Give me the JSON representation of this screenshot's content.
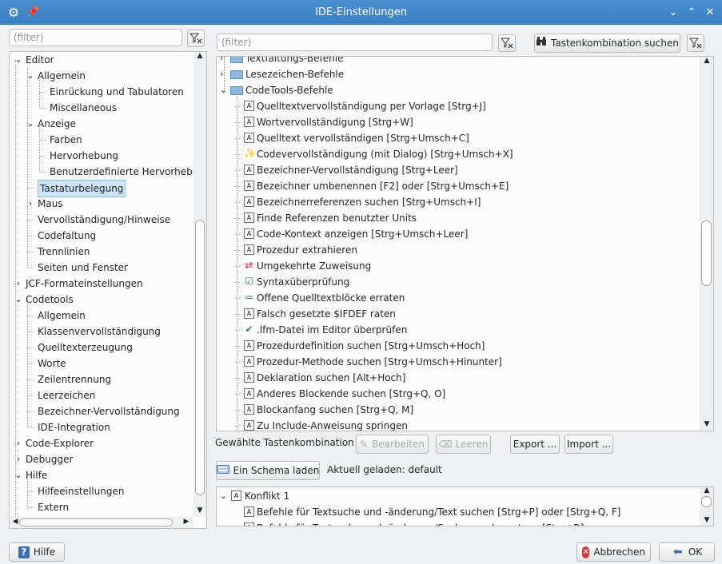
{
  "window": {
    "title": "IDE-Einstellungen",
    "app_icon": "gear-icon",
    "pin_icon": "pin-icon"
  },
  "left_filter": {
    "placeholder": "(filter)"
  },
  "tree": [
    {
      "label": "Editor",
      "level": 0,
      "expander": "down"
    },
    {
      "label": "Allgemein",
      "level": 1,
      "expander": "down"
    },
    {
      "label": "Einrückung und Tabulatoren",
      "level": 2
    },
    {
      "label": "Miscellaneous",
      "level": 2
    },
    {
      "label": "Anzeige",
      "level": 1,
      "expander": "down"
    },
    {
      "label": "Farben",
      "level": 2
    },
    {
      "label": "Hervorhebung",
      "level": 2
    },
    {
      "label": "Benutzerdefinierte Hervorhebu",
      "level": 2
    },
    {
      "label": "Tastaturbelegung",
      "level": 1,
      "selected": true
    },
    {
      "label": "Maus",
      "level": 1,
      "expander": "right"
    },
    {
      "label": "Vervollständigung/Hinweise",
      "level": 1
    },
    {
      "label": "Codefaltung",
      "level": 1
    },
    {
      "label": "Trennlinien",
      "level": 1
    },
    {
      "label": "Seiten und Fenster",
      "level": 1
    },
    {
      "label": "JCF-Formateinstellungen",
      "level": 0,
      "expander": "right"
    },
    {
      "label": "Codetools",
      "level": 0,
      "expander": "down"
    },
    {
      "label": "Allgemein",
      "level": 1
    },
    {
      "label": "Klassenvervollständigung",
      "level": 1
    },
    {
      "label": "Quelltexterzeugung",
      "level": 1
    },
    {
      "label": "Worte",
      "level": 1
    },
    {
      "label": "Zeilentrennung",
      "level": 1
    },
    {
      "label": "Leerzeichen",
      "level": 1
    },
    {
      "label": "Bezeichner-Vervollständigung",
      "level": 1
    },
    {
      "label": "IDE-Integration",
      "level": 1
    },
    {
      "label": "Code-Explorer",
      "level": 0,
      "expander": "right"
    },
    {
      "label": "Debugger",
      "level": 0,
      "expander": "right"
    },
    {
      "label": "Hilfe",
      "level": 0,
      "expander": "down"
    },
    {
      "label": "Hilfeeinstellungen",
      "level": 1
    },
    {
      "label": "Extern",
      "level": 1
    }
  ],
  "right_filter": {
    "placeholder": "(filter)"
  },
  "find_key_button": {
    "label": "Tastenkombination suchen",
    "icon": "binoculars-icon"
  },
  "commands": [
    {
      "label": "Textfaltungs-Befehle",
      "type": "folder",
      "expander": "right"
    },
    {
      "label": "Lesezeichen-Befehle",
      "type": "folder",
      "expander": "right"
    },
    {
      "label": "CodeTools-Befehle",
      "type": "folder",
      "expander": "down"
    },
    {
      "label": "Quelltextvervollständigung per Vorlage  [Strg+J]",
      "icon": "A"
    },
    {
      "label": "Wortvervollständigung  [Strg+W]",
      "icon": "A"
    },
    {
      "label": "Quelltext vervollständigen  [Strg+Umsch+C]",
      "icon": "A"
    },
    {
      "label": "Codevervollständigung (mit Dialog)  [Strg+Umsch+X]",
      "icon": "wand"
    },
    {
      "label": "Bezeichner-Vervollständigung  [Strg+Leer]",
      "icon": "A"
    },
    {
      "label": "Bezeichner umbenennen  [F2]  oder  [Strg+Umsch+E]",
      "icon": "A"
    },
    {
      "label": "Bezeichnerreferenzen suchen  [Strg+Umsch+I]",
      "icon": "A"
    },
    {
      "label": "Finde Referenzen benutzter Units",
      "icon": "A"
    },
    {
      "label": "Code-Kontext anzeigen  [Strg+Umsch+Leer]",
      "icon": "A"
    },
    {
      "label": "Prozedur extrahieren",
      "icon": "A"
    },
    {
      "label": "Umgekehrte Zuweisung",
      "icon": "swap"
    },
    {
      "label": "Syntaxüberprüfung",
      "icon": "syntax"
    },
    {
      "label": "Offene Quelltextblöcke erraten",
      "icon": "guess"
    },
    {
      "label": "Falsch gesetzte $IFDEF raten",
      "icon": "A"
    },
    {
      "label": ".lfm-Datei im Editor überprüfen",
      "icon": "check"
    },
    {
      "label": "Prozedurdefinition suchen  [Strg+Umsch+Hoch]",
      "icon": "A"
    },
    {
      "label": "Prozedur-Methode suchen  [Strg+Umsch+Hinunter]",
      "icon": "A"
    },
    {
      "label": "Deklaration suchen  [Alt+Hoch]",
      "icon": "A"
    },
    {
      "label": "Anderes Blockende suchen  [Strg+Q, O]",
      "icon": "A"
    },
    {
      "label": "Blockanfang suchen  [Strg+Q, M]",
      "icon": "A"
    },
    {
      "label": "Zu Include-Anweisung springen",
      "icon": "A"
    }
  ],
  "selected_key_label": "Gewählte Tastenkombination",
  "edit_button": {
    "label": "Bearbeiten",
    "icon": "pencil-icon"
  },
  "clear_button": {
    "label": "Leeren",
    "icon": "eraser-icon"
  },
  "export_button": {
    "label": "Export ..."
  },
  "import_button": {
    "label": "Import ..."
  },
  "load_scheme_button": {
    "label": "Ein Schema laden",
    "icon": "keyboard-icon"
  },
  "current_loaded": "Aktuell geladen: default",
  "conflicts": [
    {
      "label": "Konflikt 1",
      "expander": "down"
    },
    {
      "label": "Befehle für Textsuche und -änderung/Text suchen  [Strg+P]  oder  [Strg+Q, F]"
    },
    {
      "label": "Befehle für Textsuche und -änderung/Suchen und ersetzen  [Strg+R]"
    }
  ],
  "help_button": {
    "label": "Hilfe",
    "icon": "help-icon"
  },
  "cancel_button": {
    "label": "Abbrechen",
    "icon": "cancel-icon"
  },
  "ok_button": {
    "label": "OK",
    "icon": "ok-arrow-icon"
  }
}
